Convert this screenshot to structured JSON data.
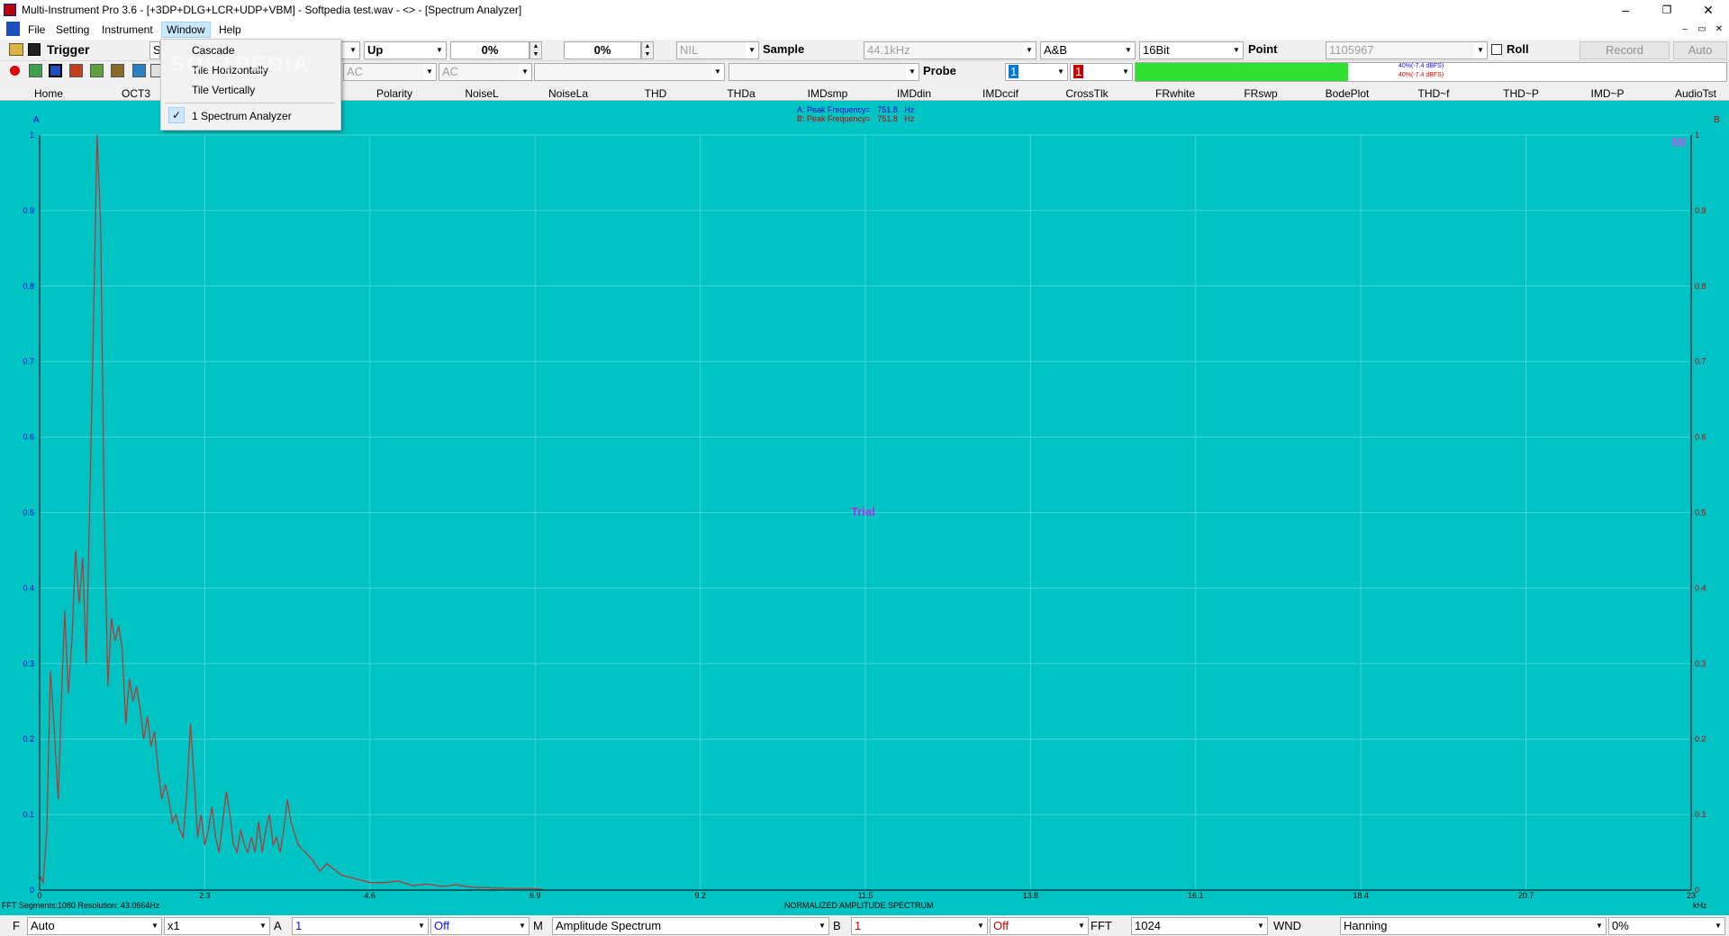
{
  "window": {
    "title": "Multi-Instrument Pro 3.6  -  [+3DP+DLG+LCR+UDP+VBM]   -   Softpedia test.wav   -   <> - [Spectrum Analyzer]",
    "minimize": "–",
    "restore": "❐",
    "close": "✕"
  },
  "menu": {
    "items": [
      "File",
      "Setting",
      "Instrument",
      "Window",
      "Help"
    ],
    "active": "Window",
    "mdi_controls": [
      "–",
      "▭",
      "✕"
    ]
  },
  "window_menu": {
    "items": [
      "Cascade",
      "Tile Horizontally",
      "Tile Vertically",
      "1 Spectrum Analyzer"
    ],
    "checked": "1 Spectrum Analyzer",
    "watermark": "SOFTPEDIA"
  },
  "toolbar1": {
    "trigger_label": "Trigger",
    "trigger_combo": "S",
    "slope": "Up",
    "spin1": "0%",
    "spin2": "0%",
    "channel_combo": "NIL",
    "sample_label": "Sample",
    "sample_rate": "44.1kHz",
    "channels": "A&B",
    "bits": "16Bit",
    "point_label": "Point",
    "point_value": "1105967",
    "roll_label": "Roll",
    "record_button": "Record",
    "auto_button": "Auto"
  },
  "toolbar2": {
    "coupling_a": "AC",
    "coupling_b": "AC",
    "probe_label": "Probe",
    "probe_a": "1",
    "probe_b": "1",
    "level_a_text": "40%(-7.4 dBFS)",
    "level_b_text": "40%(-7.4 dBFS)",
    "level_a_pct": 40,
    "level_b_pct": 40
  },
  "tabs": [
    "Home",
    "OCT3",
    "Polarity",
    "NoiseL",
    "NoiseLa",
    "THD",
    "THDa",
    "IMDsmp",
    "IMDdin",
    "IMDccif",
    "CrossTlk",
    "FRwhite",
    "FRswp",
    "BodePlot",
    "THD~f",
    "THD~P",
    "IMD~P",
    "AudioTst"
  ],
  "plot": {
    "channel_a_label": "A",
    "channel_b_label": "B",
    "peak_a_label": "A: Peak Frequency=",
    "peak_a_value": "751.8",
    "peak_a_unit": "Hz",
    "peak_b_label": "B: Peak Frequency=",
    "peak_b_value": "751.8",
    "peak_b_unit": "Hz",
    "watermark": "Trial",
    "logo": "MI",
    "footer_left": "FFT  Segments:1080    Resolution: 43.0664Hz",
    "footer_center": "NORMALIZED AMPLITUDE SPECTRUM",
    "x_unit": "kHz",
    "colors": {
      "background": "#00c4c4",
      "trace": "#c0302e",
      "grid": "#3dd6d6",
      "axis_a": "#0000c8",
      "axis_b": "#c80000"
    }
  },
  "chart_data": {
    "type": "line",
    "title": "NORMALIZED AMPLITUDE SPECTRUM",
    "xlabel": "kHz",
    "ylabel": "",
    "xlim": [
      0,
      23
    ],
    "ylim": [
      0,
      1
    ],
    "x_ticks": [
      "0",
      "2.3",
      "4.6",
      "6.9",
      "9.2",
      "11.5",
      "13.8",
      "16.1",
      "18.4",
      "20.7",
      "23"
    ],
    "y_ticks": [
      "0",
      "0.1",
      "0.2",
      "0.3",
      "0.4",
      "0.5",
      "0.6",
      "0.7",
      "0.8",
      "0.9",
      "1"
    ],
    "series": [
      {
        "name": "A",
        "x": [
          0,
          0.05,
          0.1,
          0.15,
          0.2,
          0.26,
          0.3,
          0.35,
          0.4,
          0.45,
          0.5,
          0.55,
          0.6,
          0.65,
          0.7,
          0.75,
          0.8,
          0.85,
          0.9,
          0.95,
          1.0,
          1.05,
          1.1,
          1.15,
          1.2,
          1.25,
          1.3,
          1.35,
          1.4,
          1.45,
          1.5,
          1.55,
          1.6,
          1.65,
          1.7,
          1.75,
          1.8,
          1.85,
          1.9,
          1.95,
          2.0,
          2.05,
          2.1,
          2.15,
          2.2,
          2.25,
          2.3,
          2.35,
          2.4,
          2.45,
          2.5,
          2.55,
          2.6,
          2.65,
          2.7,
          2.75,
          2.8,
          2.85,
          2.9,
          2.95,
          3.0,
          3.05,
          3.1,
          3.15,
          3.2,
          3.25,
          3.3,
          3.35,
          3.4,
          3.45,
          3.5,
          3.6,
          3.7,
          3.8,
          3.9,
          4.0,
          4.2,
          4.4,
          4.6,
          4.8,
          5.0,
          5.2,
          5.4,
          5.6,
          5.8,
          6.0,
          6.3,
          6.6,
          6.9,
          7.0
        ],
        "y": [
          0.02,
          0.01,
          0.08,
          0.29,
          0.22,
          0.12,
          0.24,
          0.37,
          0.26,
          0.33,
          0.45,
          0.38,
          0.44,
          0.3,
          0.52,
          0.75,
          1.0,
          0.88,
          0.5,
          0.27,
          0.36,
          0.33,
          0.35,
          0.32,
          0.22,
          0.28,
          0.25,
          0.27,
          0.24,
          0.2,
          0.23,
          0.19,
          0.21,
          0.16,
          0.12,
          0.14,
          0.12,
          0.09,
          0.1,
          0.08,
          0.07,
          0.13,
          0.22,
          0.15,
          0.07,
          0.1,
          0.06,
          0.08,
          0.11,
          0.07,
          0.05,
          0.09,
          0.13,
          0.1,
          0.06,
          0.05,
          0.08,
          0.06,
          0.05,
          0.07,
          0.05,
          0.09,
          0.05,
          0.08,
          0.1,
          0.06,
          0.07,
          0.05,
          0.08,
          0.12,
          0.09,
          0.06,
          0.05,
          0.04,
          0.025,
          0.035,
          0.02,
          0.015,
          0.01,
          0.01,
          0.012,
          0.006,
          0.008,
          0.005,
          0.007,
          0.004,
          0.003,
          0.002,
          0.002,
          0.001
        ]
      }
    ]
  },
  "bottom": {
    "f_label": "F",
    "f_value": "Auto",
    "mult": "x1",
    "a_label": "A",
    "a_value": "1",
    "a_off": "Off",
    "m_label": "M",
    "mode": "Amplitude Spectrum",
    "b_label": "B",
    "b_value": "1",
    "b_off": "Off",
    "fft_label": "FFT",
    "fft_size": "1024",
    "wnd_label": "WND",
    "window_fn": "Hanning",
    "overlap": "0%"
  }
}
